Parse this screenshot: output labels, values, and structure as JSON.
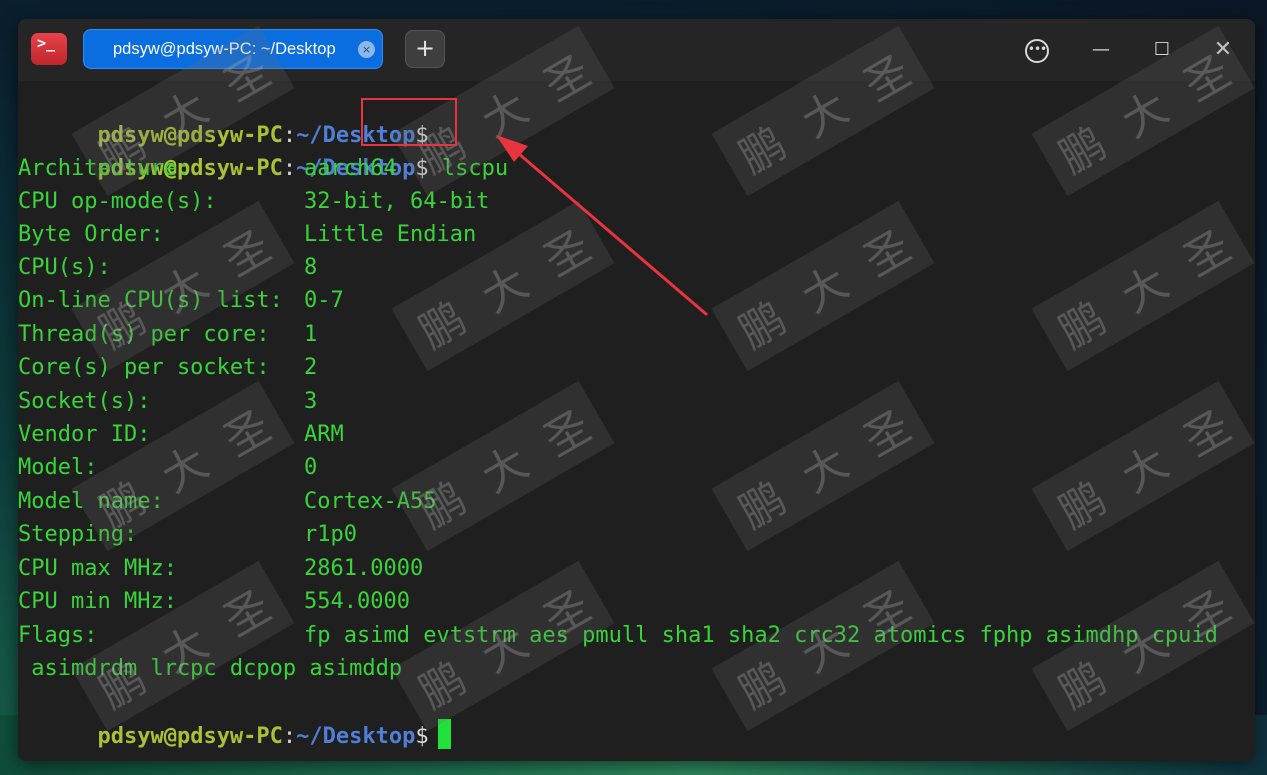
{
  "window": {
    "tab_title": "pdsyw@pdsyw-PC: ~/Desktop",
    "tab_close_glyph": "×",
    "new_tab_glyph": "+",
    "menu_glyph": "•••",
    "minimize_glyph": "—",
    "maximize_glyph": "☐",
    "close_glyph": "✕",
    "app_icon_glyph": ">_"
  },
  "prompt": {
    "user_host": "pdsyw@pdsyw-PC",
    "colon": ":",
    "path": "~/Desktop",
    "dollar": "$"
  },
  "command": "lscpu",
  "output": [
    {
      "key": "Architecture:",
      "value": "aarch64"
    },
    {
      "key": "CPU op-mode(s):",
      "value": "32-bit, 64-bit"
    },
    {
      "key": "Byte Order:",
      "value": "Little Endian"
    },
    {
      "key": "CPU(s):",
      "value": "8"
    },
    {
      "key": "On-line CPU(s) list:",
      "value": "0-7"
    },
    {
      "key": "Thread(s) per core:",
      "value": "1"
    },
    {
      "key": "Core(s) per socket:",
      "value": "2"
    },
    {
      "key": "Socket(s):",
      "value": "3"
    },
    {
      "key": "Vendor ID:",
      "value": "ARM"
    },
    {
      "key": "Model:",
      "value": "0"
    },
    {
      "key": "Model name:",
      "value": "Cortex-A55"
    },
    {
      "key": "Stepping:",
      "value": "r1p0"
    },
    {
      "key": "CPU max MHz:",
      "value": "2861.0000"
    },
    {
      "key": "CPU min MHz:",
      "value": "554.0000"
    },
    {
      "key": "Flags:",
      "value": "fp asimd evtstrm aes pmull sha1 sha2 crc32 atomics fphp asimdhp cpuid"
    }
  ],
  "flags_continuation": " asimdrdm lrcpc dcpop asimddp",
  "watermark_text": "鹏  大  圣",
  "colors": {
    "terminal_bg": "#1f1f1f",
    "text_green": "#39d43a",
    "prompt_user": "#a9c135",
    "prompt_path": "#4f7fd6",
    "tab_blue": "#0b6ee0",
    "annotation_red": "#e8343f"
  }
}
